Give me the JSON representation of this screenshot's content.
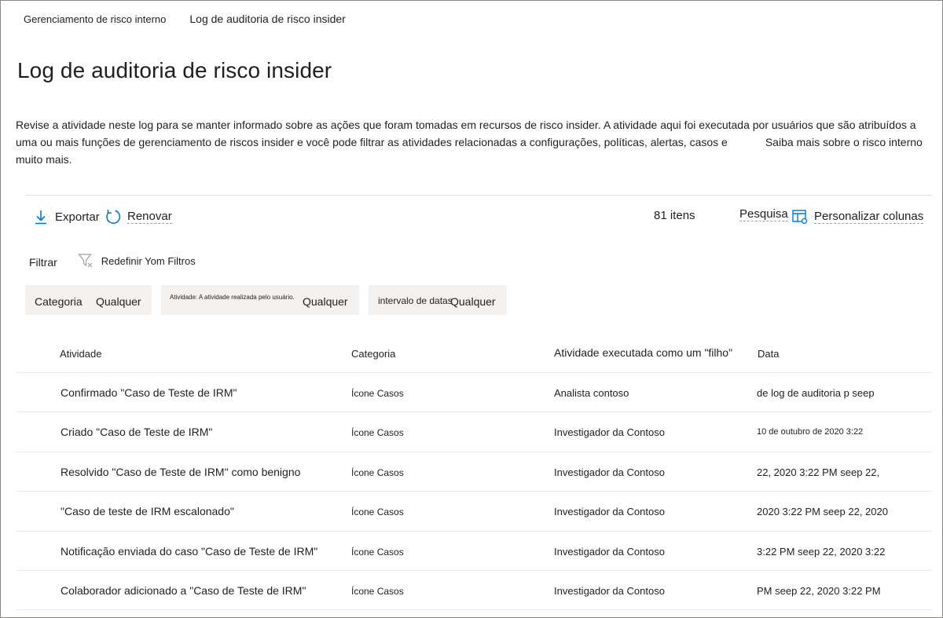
{
  "breadcrumb": {
    "parent": "Gerenciamento de risco interno",
    "current": "Log de auditoria de risco insider"
  },
  "page": {
    "title": "Log de auditoria de risco insider",
    "description_line1": "Revise a atividade neste log para se manter informado sobre as ações que foram tomadas em recursos de risco insider. A atividade aqui foi executada por usuários que são atribuídos a",
    "description_line2": "uma ou mais funções de gerenciamento de riscos insider e você pode filtrar as atividades relacionadas a configurações, políticas, alertas, casos e",
    "learn_more": "Saiba mais sobre o risco interno",
    "description_line3": "muito mais."
  },
  "toolbar": {
    "export_label": "Exportar",
    "refresh_label": "Renovar",
    "items_count": "81 itens",
    "search_label": "Pesquisa",
    "customize_label": "Personalizar colunas"
  },
  "filters": {
    "label": "Filtrar",
    "reset_label": "Redefinir Yom Filtros",
    "chips": [
      {
        "label": "Categoria",
        "value": "Qualquer"
      },
      {
        "label": "Atividade: A atividade realizada pelo usuário.",
        "value": "Qualquer"
      },
      {
        "label": "intervalo de datas",
        "value": "Qualquer"
      }
    ]
  },
  "table": {
    "headers": {
      "activity": "Atividade",
      "category": "Categoria",
      "actor": "Atividade executada como um \"filho\"",
      "date": "Data"
    },
    "rows": [
      {
        "activity": "Confirmado \"Caso de Teste de IRM\"",
        "category": "Ícone Casos",
        "actor": "Analista contoso",
        "date": "de log de auditoria p seep"
      },
      {
        "activity": "Criado \"Caso de Teste de IRM\"",
        "category": "Ícone Casos",
        "actor": "Investigador da Contoso",
        "date": "10 de outubro de 2020 3:22"
      },
      {
        "activity": "Resolvido \"Caso de Teste de IRM\" como benigno",
        "category": "Ícone Casos",
        "actor": "Investigador da Contoso",
        "date": "22, 2020 3:22 PM seep 22,"
      },
      {
        "activity": "\"Caso de teste de IRM escalonado\"",
        "category": "Ícone Casos",
        "actor": "Investigador da Contoso",
        "date": "2020 3:22 PM seep 22, 2020"
      },
      {
        "activity": "Notificação enviada do caso \"Caso de Teste de IRM\"",
        "category": "Ícone Casos",
        "actor": "Investigador da Contoso",
        "date": "3:22 PM seep 22, 2020 3:22"
      },
      {
        "activity": "Colaborador adicionado a \"Caso de Teste de IRM\"",
        "category": "Ícone Casos",
        "actor": "Investigador da Contoso",
        "date": "PM seep 22, 2020 3:22 PM"
      }
    ]
  },
  "colors": {
    "accent": "#0078d4",
    "text": "#201f1e",
    "chip_bg": "#f3f2f1",
    "divider": "#e1dfdd"
  }
}
